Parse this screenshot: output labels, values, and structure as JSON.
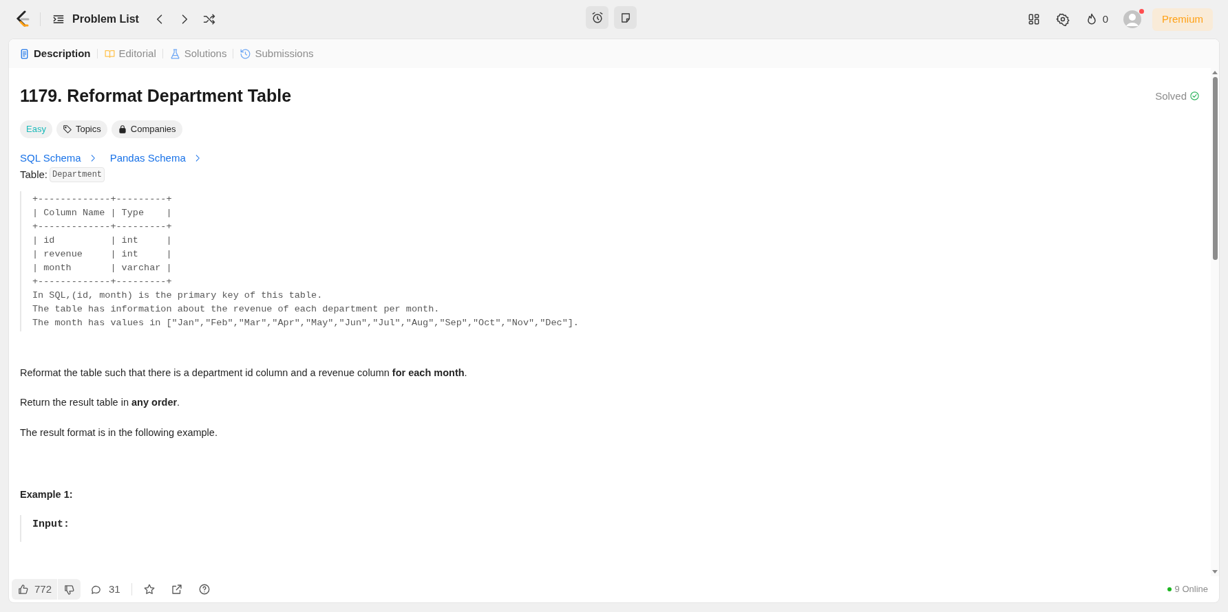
{
  "top_bar": {
    "nav_label": "Problem List",
    "streak_count": "0",
    "avatar_notification": true,
    "premium_label": "Premium"
  },
  "tabs": [
    {
      "label": "Description",
      "kind": "description",
      "selected": true
    },
    {
      "label": "Editorial",
      "kind": "editorial",
      "selected": false
    },
    {
      "label": "Solutions",
      "kind": "solutions",
      "selected": false
    },
    {
      "label": "Submissions",
      "kind": "submissions",
      "selected": false
    }
  ],
  "problem": {
    "title": "1179. Reformat Department Table",
    "status": "Solved",
    "difficulty": "Easy",
    "tags": [
      {
        "label": "Topics",
        "kind": "tag"
      },
      {
        "label": "Companies",
        "kind": "lock"
      }
    ],
    "schema_links": [
      "SQL Schema",
      "Pandas Schema"
    ],
    "table_label": "Table:",
    "table_name": "Department",
    "code_lines": [
      "+-------------+---------+",
      "| Column Name | Type    |",
      "+-------------+---------+",
      "| id          | int     |",
      "| revenue     | int     |",
      "| month       | varchar |",
      "+-------------+---------+",
      "In SQL,(id, month) is the primary key of this table.",
      "The table has information about the revenue of each department per month.",
      "The month has values in [\"Jan\",\"Feb\",\"Mar\",\"Apr\",\"May\",\"Jun\",\"Jul\",\"Aug\",\"Sep\",\"Oct\",\"Nov\",\"Dec\"]."
    ],
    "paragraphs": [
      "Reformat the table such that there is a department id column and a revenue column **for each month**.",
      "Return the result table in **any order**.",
      "The result format is in the following example."
    ],
    "example_heading": "Example 1:",
    "example_input_label": "Input:"
  },
  "footer": {
    "likes": "772",
    "comments": "31",
    "online": "9 Online"
  }
}
